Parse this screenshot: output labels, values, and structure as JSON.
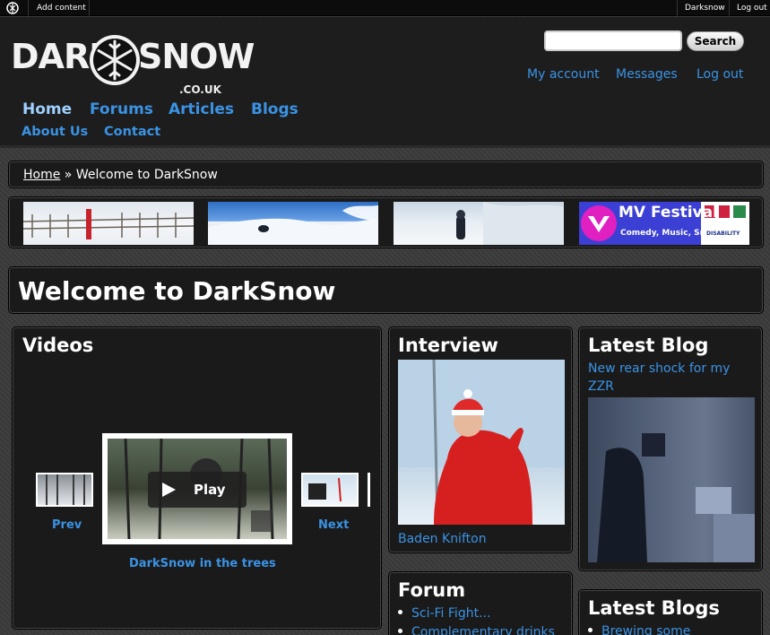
{
  "toolbar": {
    "add_content": "Add content",
    "username": "Darksnow",
    "logout": "Log out"
  },
  "header": {
    "logo_left": "DARK",
    "logo_right": "SNOW",
    "logo_sub": ".CO.UK",
    "search": {
      "value": "",
      "button": "Search"
    },
    "user_links": [
      "My account",
      "Messages",
      "Log out"
    ],
    "primary_nav": [
      "Home",
      "Forums",
      "Articles",
      "Blogs"
    ],
    "secondary_nav": [
      "About Us",
      "Contact"
    ]
  },
  "breadcrumb": {
    "home": "Home",
    "separator": "»",
    "current": "Welcome to DarkSnow"
  },
  "banners": {
    "mv_title": "MV Festival",
    "mv_subtitle": "Comedy, Music, Snow",
    "mv_sponsor": "DISABILITY"
  },
  "page_title": "Welcome to DarkSnow",
  "videos": {
    "title": "Videos",
    "prev": "Prev",
    "next": "Next",
    "play": "Play",
    "caption": "DarkSnow in the trees"
  },
  "interview": {
    "title": "Interview",
    "name": "Baden Knifton"
  },
  "forum": {
    "title": "Forum",
    "items": [
      "Sci-Fi Fight...",
      "Complementary drinks"
    ]
  },
  "latest_blog": {
    "title": "Latest Blog",
    "link": "New rear shock for my ZZR"
  },
  "latest_blogs": {
    "title": "Latest Blogs",
    "items": [
      "Brewing some"
    ]
  },
  "colors": {
    "link": "#3b93e4",
    "panel": "#1a1a1a",
    "header": "#1d1d1d"
  }
}
